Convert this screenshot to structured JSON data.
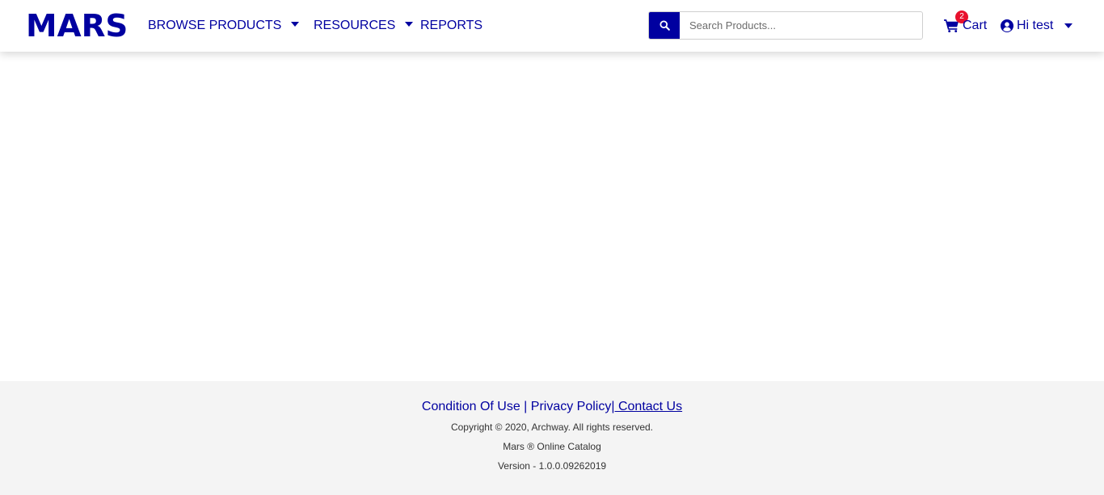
{
  "brand": {
    "logo_text": "MARS",
    "color": "#0000a0"
  },
  "nav": {
    "browse_products": "BROWSE PRODUCTS",
    "resources": "RESOURCES",
    "reports": "REPORTS"
  },
  "search": {
    "placeholder": "Search Products...",
    "value": "",
    "icon": "search-icon"
  },
  "cart": {
    "label": "Cart",
    "count": "2",
    "badge_color": "#e8112d",
    "icon": "shopping-cart-icon"
  },
  "user": {
    "greeting": "Hi test",
    "icon": "user-circle-icon"
  },
  "footer": {
    "condition_of_use": "Condition Of Use",
    "separator1": " | ",
    "privacy_policy": "Privacy Policy",
    "separator2": "|",
    "contact_us": " Contact Us",
    "copyright": "Copyright © 2020, Archway. All rights reserved.",
    "catalog": "Mars ® Online Catalog",
    "version": "Version - 1.0.0.09262019"
  }
}
